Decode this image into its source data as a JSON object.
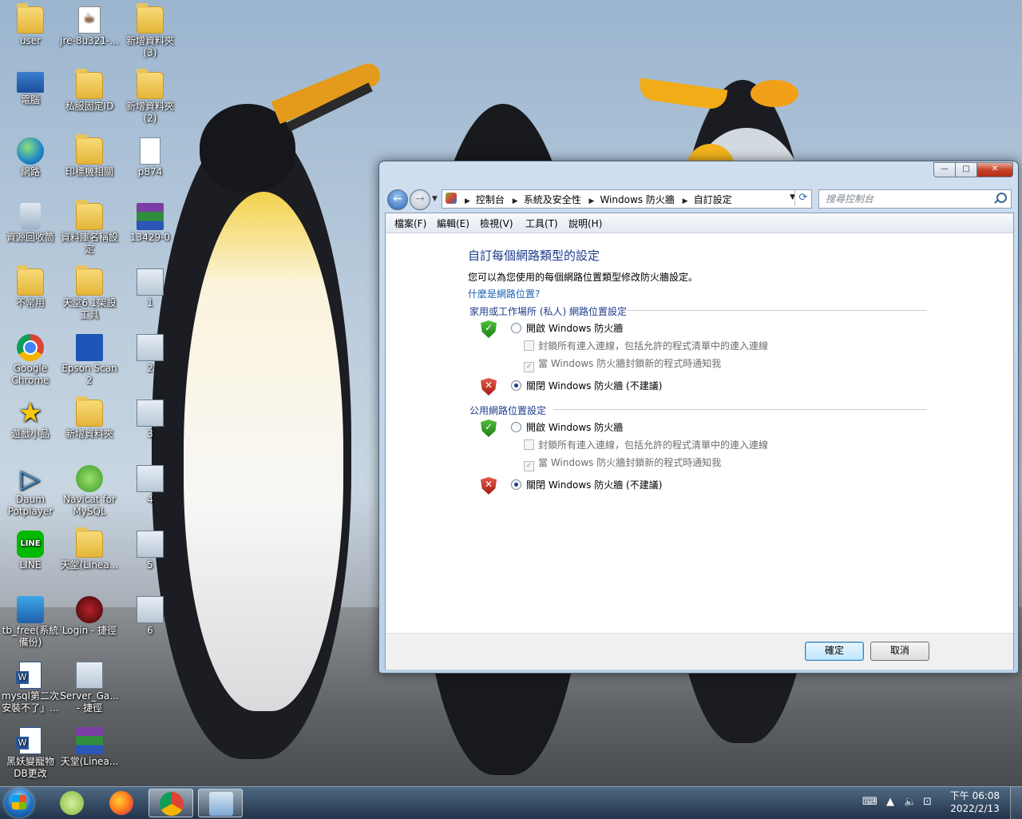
{
  "desktop_icons": [
    {
      "label": "user",
      "icon": "user-folder-icon"
    },
    {
      "label": "jre-8u321-...",
      "icon": "java-installer-icon"
    },
    {
      "label": "新增資料夾 (3)",
      "icon": "folder-icon"
    },
    {
      "label": "電腦",
      "icon": "computer-icon"
    },
    {
      "label": "私服固定ID",
      "icon": "folder-icon"
    },
    {
      "label": "新增資料夾 (2)",
      "icon": "folder-icon"
    },
    {
      "label": "網路",
      "icon": "network-icon"
    },
    {
      "label": "印標機相關",
      "icon": "folder-icon"
    },
    {
      "label": "p874",
      "icon": "document-icon"
    },
    {
      "label": "資源回收筒",
      "icon": "recycle-bin-icon"
    },
    {
      "label": "資料庫名稱設定",
      "icon": "folder-icon"
    },
    {
      "label": "13429-0",
      "icon": "winrar-icon"
    },
    {
      "label": "不常用",
      "icon": "folder-icon"
    },
    {
      "label": "天堂6.1架設工具",
      "icon": "folder-icon"
    },
    {
      "label": "1",
      "icon": "app-window-icon"
    },
    {
      "label": "Google Chrome",
      "icon": "chrome-icon"
    },
    {
      "label": "Epson Scan 2",
      "icon": "epson-scan-icon"
    },
    {
      "label": "2",
      "icon": "app-window-icon"
    },
    {
      "label": "遊戲小品",
      "icon": "star-icon"
    },
    {
      "label": "新增資料夾",
      "icon": "folder-icon"
    },
    {
      "label": "3",
      "icon": "app-window-icon"
    },
    {
      "label": "Daum Potplayer",
      "icon": "potplayer-icon"
    },
    {
      "label": "Navicat for MySQL",
      "icon": "navicat-icon"
    },
    {
      "label": "4",
      "icon": "app-window-icon"
    },
    {
      "label": "LINE",
      "icon": "line-icon"
    },
    {
      "label": "天堂(Linea...",
      "icon": "folder-icon"
    },
    {
      "label": "5",
      "icon": "app-window-icon"
    },
    {
      "label": "tb_free(系統備份)",
      "icon": "tb-backup-icon"
    },
    {
      "label": "Login - 捷徑",
      "icon": "lineage-login-icon"
    },
    {
      "label": "6",
      "icon": "app-window-icon"
    },
    {
      "label": "mysql第二次安裝不了」...",
      "icon": "word-doc-icon"
    },
    {
      "label": "Server_Ga... - 捷徑",
      "icon": "server-app-icon"
    },
    {
      "label": "黑妖變寵物DB更改",
      "icon": "word-doc-icon"
    },
    {
      "label": "天堂(Linea...",
      "icon": "winrar-icon"
    }
  ],
  "window": {
    "controls": {
      "minimize": "—",
      "maximize": "□",
      "close": "✕"
    },
    "address": {
      "crumbs": [
        "控制台",
        "系統及安全性",
        "Windows 防火牆",
        "自訂設定"
      ]
    },
    "search": {
      "placeholder": "搜尋控制台"
    },
    "menu": [
      "檔案(F)",
      "編輯(E)",
      "檢視(V)",
      "工具(T)",
      "說明(H)"
    ],
    "content": {
      "title": "自訂每個網路類型的設定",
      "description": "您可以為您使用的每個網路位置類型修改防火牆設定。",
      "link": "什麼是網路位置?",
      "sections": [
        {
          "heading": "家用或工作場所 (私人) 網路位置設定",
          "enable_label": "開啟 Windows 防火牆",
          "enable_selected": false,
          "block_all_label": "封鎖所有連入連線，包括允許的程式清單中的連入連線",
          "block_all_checked": false,
          "notify_label": "當 Windows 防火牆封鎖新的程式時通知我",
          "notify_checked": true,
          "disable_label": "關閉 Windows 防火牆 (不建議)",
          "disable_selected": true
        },
        {
          "heading": "公用網路位置設定",
          "enable_label": "開啟 Windows 防火牆",
          "enable_selected": false,
          "block_all_label": "封鎖所有連入連線，包括允許的程式清單中的連入連線",
          "block_all_checked": false,
          "notify_label": "當 Windows 防火牆封鎖新的程式時通知我",
          "notify_checked": true,
          "disable_label": "關閉 Windows 防火牆 (不建議)",
          "disable_selected": true
        }
      ]
    },
    "buttons": {
      "ok": "確定",
      "cancel": "取消"
    }
  },
  "taskbar": {
    "apps": [
      "start-button",
      "clipboard-app",
      "firefox",
      "chrome",
      "control-panel"
    ],
    "clock": {
      "time": "下午 06:08",
      "date": "2022/2/13"
    }
  }
}
